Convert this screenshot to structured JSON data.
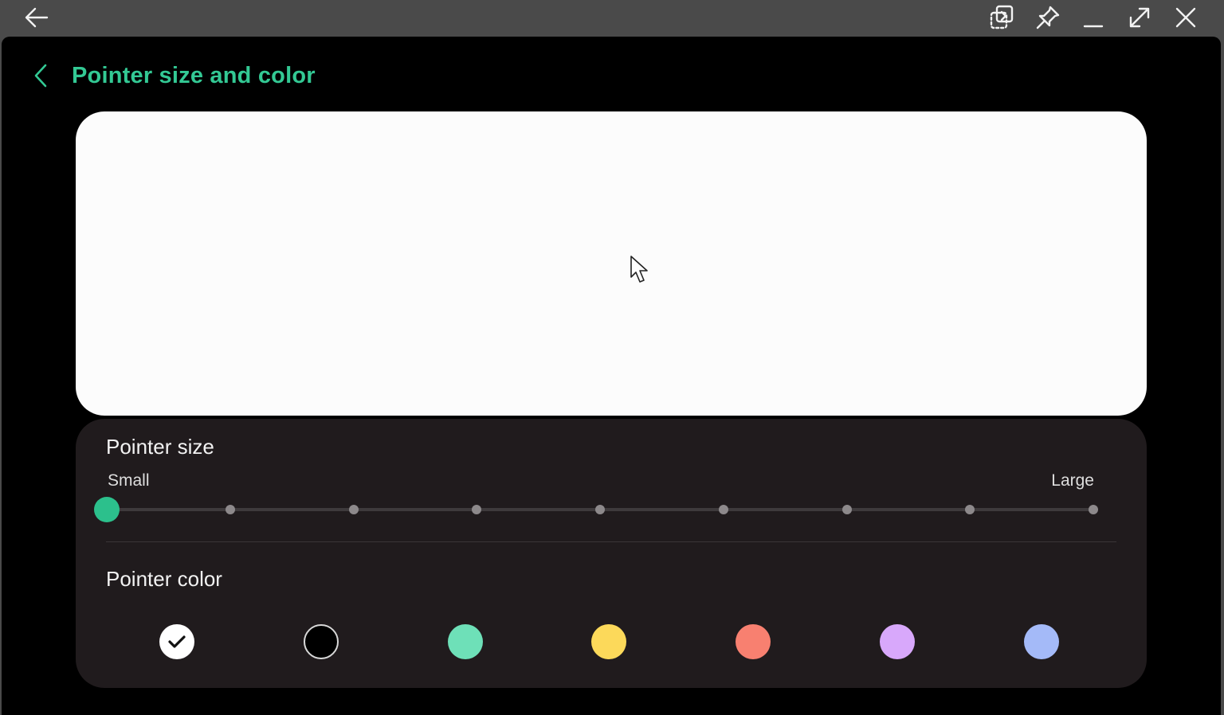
{
  "titlebar": {
    "icons": [
      "back-arrow-icon",
      "screenshot-select-icon",
      "pin-icon",
      "minimize-icon",
      "maximize-icon",
      "close-icon"
    ]
  },
  "header": {
    "title": "Pointer size and color",
    "back_icon": "chevron-left-icon",
    "accent_color": "#33c994"
  },
  "preview": {
    "background": "#fcfcfc",
    "cursor_icon": "mouse-pointer-icon"
  },
  "pointer_size": {
    "title": "Pointer size",
    "min_label": "Small",
    "max_label": "Large",
    "steps": 9,
    "selected_step": 1,
    "thumb_color": "#2cc08c"
  },
  "pointer_color": {
    "title": "Pointer color",
    "selected_index": 0,
    "options": [
      {
        "name": "white",
        "color": "#ffffff"
      },
      {
        "name": "black",
        "color": "#000000"
      },
      {
        "name": "green",
        "color": "#6ee0b8"
      },
      {
        "name": "yellow",
        "color": "#fcd95a"
      },
      {
        "name": "red",
        "color": "#f88070"
      },
      {
        "name": "purple",
        "color": "#d8a8fb"
      },
      {
        "name": "blue",
        "color": "#a4baf8"
      }
    ]
  }
}
